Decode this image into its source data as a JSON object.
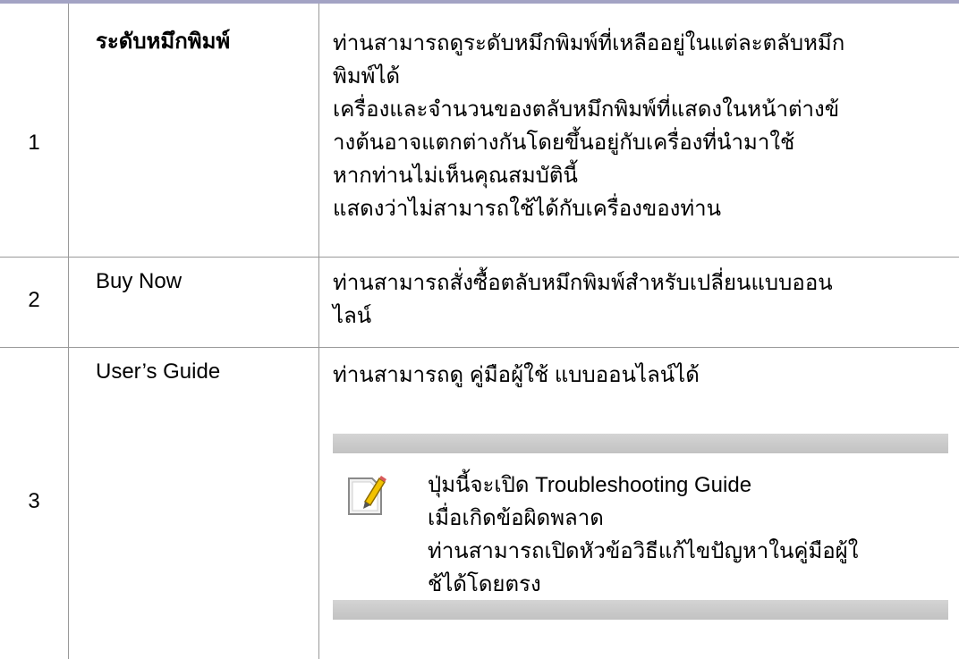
{
  "rows": [
    {
      "number": "1",
      "name": "ระดับหมึกพิมพ์",
      "description": [
        "ท่านสามารถดูระดับหมึกพิมพ์ที่เหลืออยู่ในแต่ละตลับหมึก",
        "พิมพ์ได้",
        "เครื่องและจำนวนของตลับหมึกพิมพ์ที่แสดงในหน้าต่างข้",
        "างต้นอาจแตกต่างกันโดยขึ้นอยู่กับเครื่องที่นำมาใช้",
        "หากท่านไม่เห็นคุณสมบัตินี้",
        "แสดงว่าไม่สามารถใช้ได้กับเครื่องของท่าน"
      ]
    },
    {
      "number": "2",
      "name": "Buy Now",
      "description": [
        "ท่านสามารถสั่งซื้อตลับหมึกพิมพ์สำหรับเปลี่ยนแบบออน",
        "ไลน์"
      ]
    },
    {
      "number": "3",
      "name": "User’s Guide",
      "description": [
        "ท่านสามารถดู คู่มือผู้ใช้ แบบออนไลน์ได้"
      ],
      "note": {
        "icon": "note-pencil-icon",
        "prefix": "ปุ่มนี้จะเปิด ",
        "emphasis": "Troubleshooting Guide",
        "lines": [
          "เมื่อเกิดข้อผิดพลาด",
          "ท่านสามารถเปิดหัวข้อวิธีแก้ไขปัญหาในคู่มือผู้ใ",
          "ช้ได้โดยตรง"
        ]
      }
    }
  ],
  "colors": {
    "top_rule": "#a3a3c4",
    "grid_lines": "#999999",
    "note_band": "#c8c8c8"
  }
}
